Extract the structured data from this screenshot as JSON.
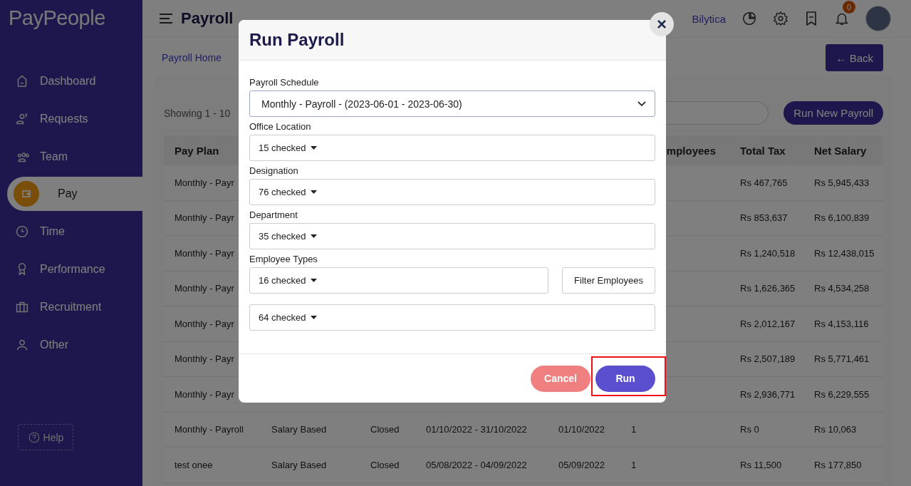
{
  "logo": "PayPeople",
  "sidebar": {
    "items": [
      {
        "label": "Dashboard",
        "selected": false
      },
      {
        "label": "Requests",
        "selected": false
      },
      {
        "label": "Team",
        "selected": false
      },
      {
        "label": "Pay",
        "selected": true
      },
      {
        "label": "Time",
        "selected": false
      },
      {
        "label": "Performance",
        "selected": false
      },
      {
        "label": "Recruitment",
        "selected": false
      },
      {
        "label": "Other",
        "selected": false
      }
    ],
    "help": "Help"
  },
  "topbar": {
    "title": "Payroll",
    "company": "Bilytica",
    "notification_count": "0"
  },
  "breadcrumb": "Payroll Home",
  "back_button": "← Back",
  "showing": "Showing 1 - 10",
  "run_new_button": "Run New Payroll",
  "table": {
    "columns": [
      "Pay Plan",
      "",
      "",
      "",
      "",
      "mployees",
      "Total Tax",
      "Net Salary"
    ],
    "rows": [
      {
        "cells": [
          "Monthly - Payr",
          "",
          "",
          "",
          "",
          "",
          "Rs 467,765",
          "Rs 5,945,433"
        ]
      },
      {
        "cells": [
          "Monthly - Payr",
          "",
          "",
          "",
          "",
          "",
          "Rs 853,637",
          "Rs 6,100,839"
        ]
      },
      {
        "cells": [
          "Monthly - Payr",
          "",
          "",
          "",
          "",
          "",
          "Rs 1,240,518",
          "Rs 12,438,015"
        ]
      },
      {
        "cells": [
          "Monthly - Payr",
          "",
          "",
          "",
          "",
          "",
          "Rs 1,626,365",
          "Rs 4,534,258"
        ]
      },
      {
        "cells": [
          "Monthly - Payr",
          "",
          "",
          "",
          "",
          "",
          "Rs 2,012,167",
          "Rs 4,153,116"
        ]
      },
      {
        "cells": [
          "Monthly - Payr",
          "",
          "",
          "",
          "",
          "",
          "Rs 2,507,189",
          "Rs 5,771,461"
        ]
      },
      {
        "cells": [
          "Monthly - Payr",
          "",
          "",
          "",
          "",
          "",
          "Rs 2,936,771",
          "Rs 6,229,555"
        ]
      },
      {
        "cells": [
          "Monthly - Payroll",
          "Salary Based",
          "Closed",
          "01/10/2022 - 31/10/2022",
          "01/10/2022",
          "1",
          "Rs 0",
          "Rs 10,063"
        ]
      },
      {
        "cells": [
          "test onee",
          "Salary Based",
          "Closed",
          "05/08/2022 - 04/09/2022",
          "05/09/2022",
          "1",
          "Rs 11,500",
          "Rs 177,850"
        ]
      }
    ]
  },
  "modal": {
    "title": "Run Payroll",
    "close": "×",
    "fields": [
      {
        "kind": "select",
        "label": "Payroll Schedule",
        "value": "Monthly - Payroll - (2023-06-01 - 2023-06-30)"
      },
      {
        "kind": "multiselect",
        "label": "Office Location",
        "value": "15 checked"
      },
      {
        "kind": "multiselect",
        "label": "Designation",
        "value": "76 checked"
      },
      {
        "kind": "multiselect",
        "label": "Department",
        "value": "35 checked"
      },
      {
        "kind": "multiselect",
        "label": "Employee Types",
        "value": "16 checked",
        "button": "Filter Employees"
      },
      {
        "kind": "multiselect",
        "value": "64 checked"
      }
    ],
    "cancel": "Cancel",
    "run": "Run"
  }
}
